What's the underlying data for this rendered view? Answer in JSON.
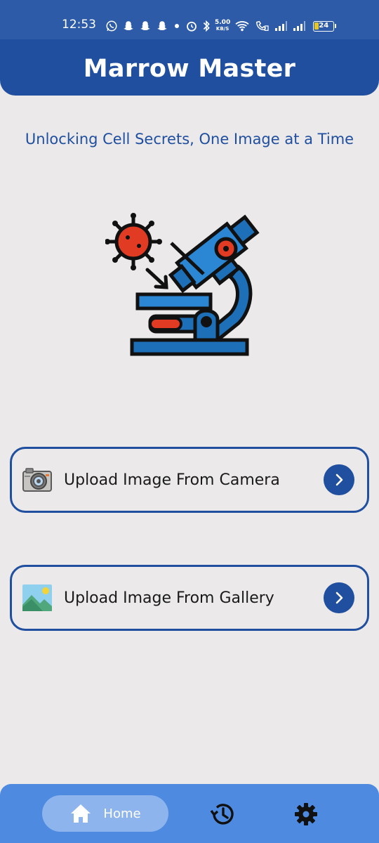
{
  "status_bar": {
    "time": "12:53",
    "net_speed_value": "5.00",
    "net_speed_unit": "KB/S",
    "battery": "24"
  },
  "app_bar": {
    "title": "Marrow Master"
  },
  "home": {
    "tagline": "Unlocking Cell Secrets, One Image at a Time",
    "hero_icon": "microscope-with-virus-illustration"
  },
  "actions": [
    {
      "label": "Upload Image From Camera",
      "icon": "camera-icon"
    },
    {
      "label": "Upload Image From Gallery",
      "icon": "gallery-icon"
    }
  ],
  "bottom_nav": {
    "home_label": "Home",
    "items": [
      "home-icon",
      "history-icon",
      "settings-icon"
    ]
  },
  "colors": {
    "primary": "#1f4f9e",
    "nav": "#4e8be0",
    "background": "#ebe9e9"
  }
}
